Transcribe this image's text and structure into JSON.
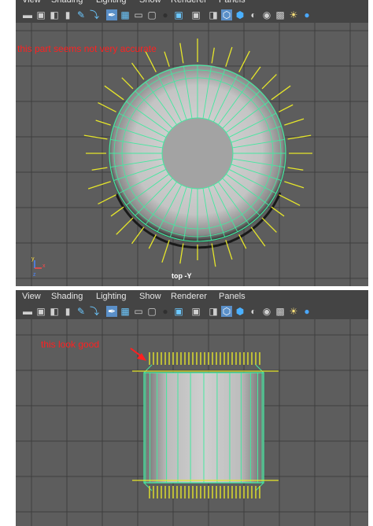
{
  "menu": {
    "items": [
      "View",
      "Shading",
      "Lighting",
      "Show",
      "Renderer",
      "Panels"
    ]
  },
  "icons": [
    "camera-icon",
    "camera-attr-icon",
    "bookmark-icon",
    "image-plane-icon",
    "2d-pan-zoom-icon",
    "grease-pencil-icon",
    "grid-icon",
    "film-gate-icon",
    "resolution-gate-icon",
    "gate-mask-icon",
    "field-chart-icon",
    "safe-action-icon",
    "safe-title-icon",
    "wireframe-icon",
    "smooth-shade-icon",
    "wireframe-on-shaded-icon",
    "textured-icon",
    "use-lights-icon",
    "shadows-icon",
    "ambient-occlusion-icon",
    "isolate-select-icon"
  ],
  "top_panel": {
    "note": "this part seems not very accurate",
    "view_label": "top -Y",
    "spoke_count": 40
  },
  "bottom_panel": {
    "note": "this look good",
    "column_count": 14
  },
  "colors": {
    "viewport_bg": "#5d5d5d",
    "grid_line": "#3e3e3e",
    "wire_green": "#44e8a0",
    "normal_yellow": "#e6e62a",
    "annotation_red": "#ff2020",
    "toolbar_bg": "#444444"
  }
}
